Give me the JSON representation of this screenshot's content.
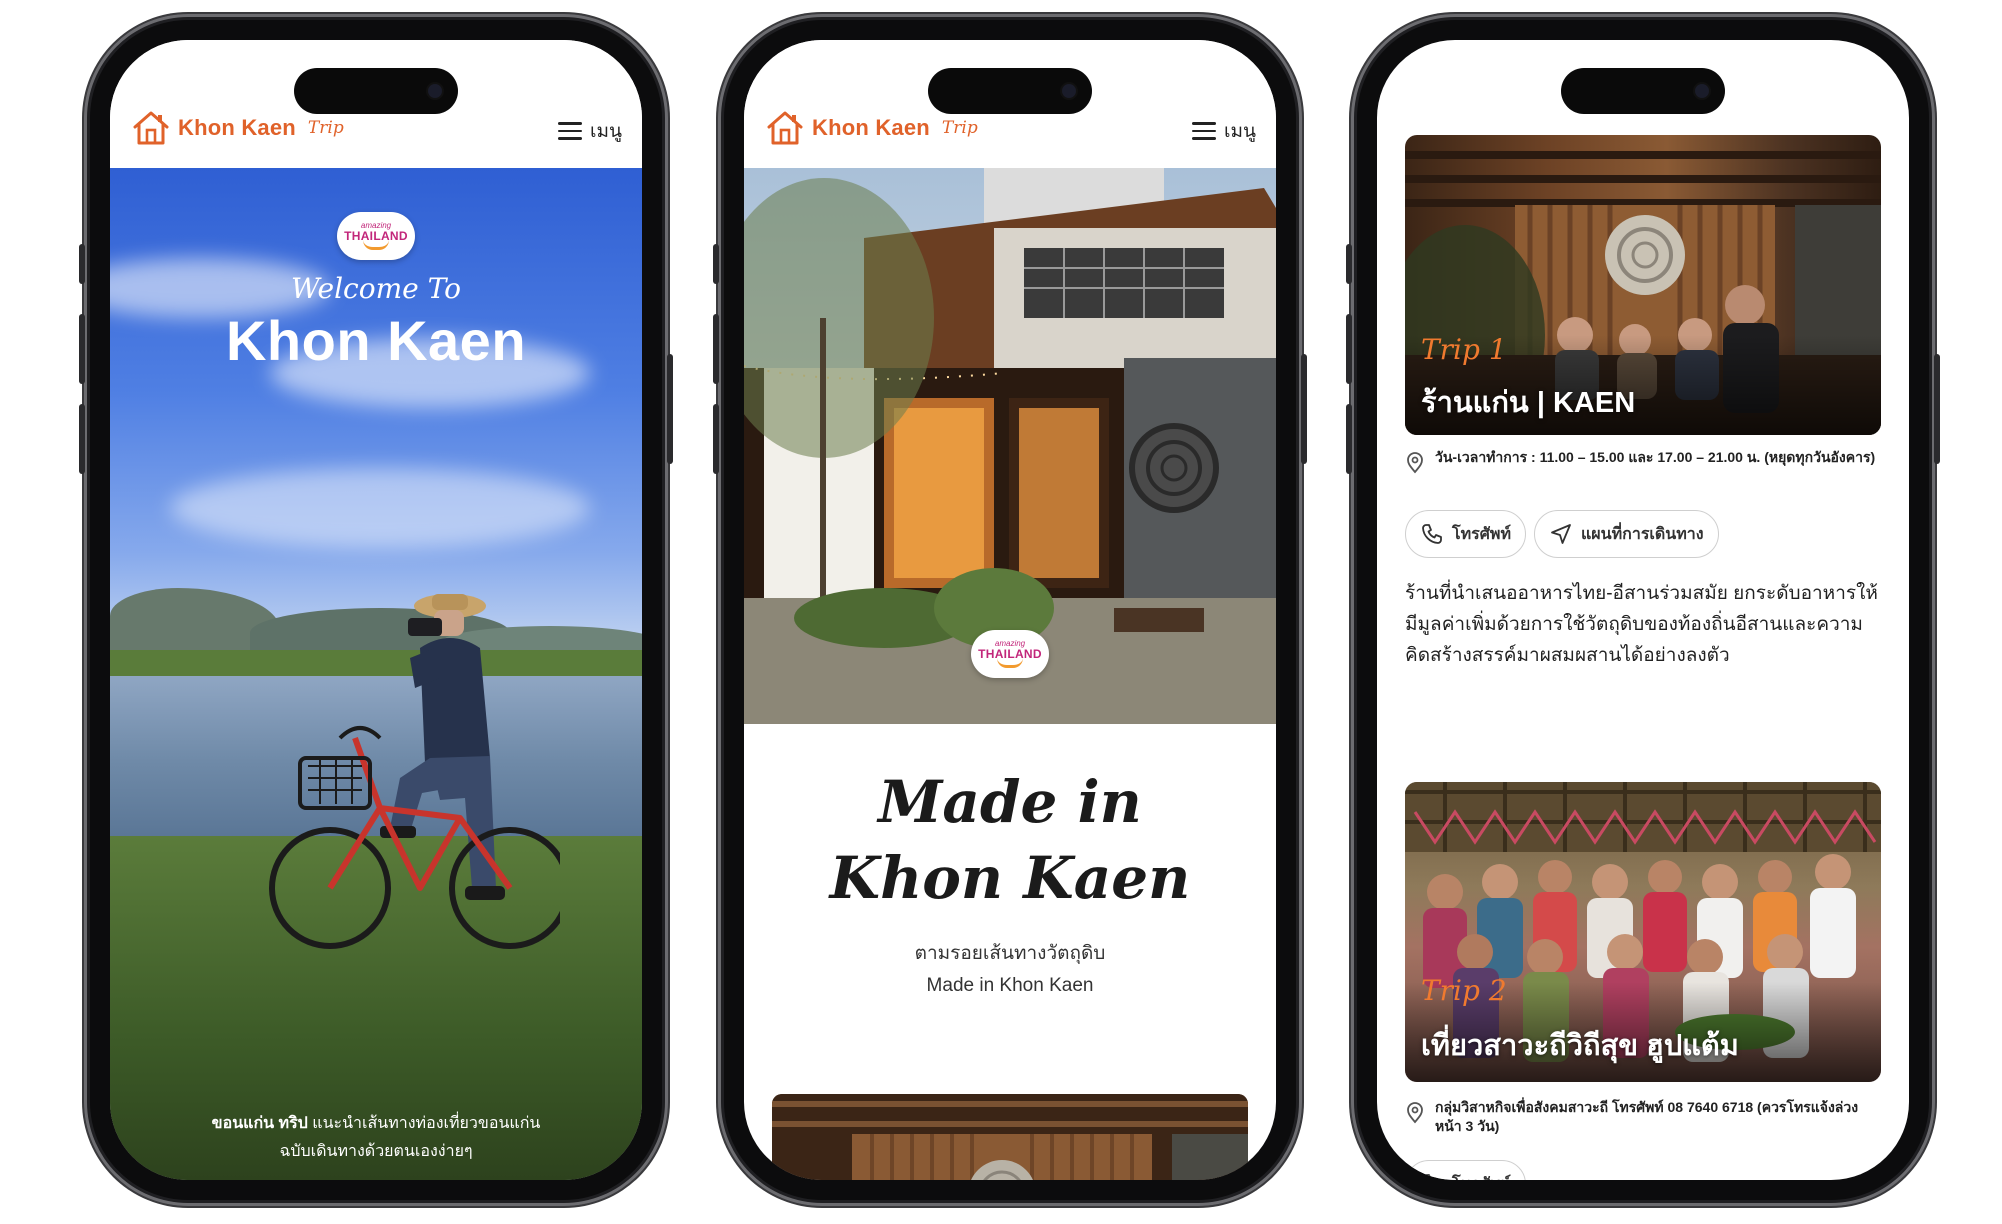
{
  "brand": {
    "name": "Khon Kaen",
    "trip": "Trip",
    "color": "#e0622a"
  },
  "menu_label": "เมนู",
  "badge": {
    "small": "amazing",
    "big": "THAILAND"
  },
  "phone1": {
    "welcome": "Welcome To",
    "title": "Khon Kaen",
    "footer_bold": "ขอนแก่น ทริป",
    "footer_line1_rest": " แนะนำเส้นทางท่องเที่ยวขอนแก่น",
    "footer_line2": "ฉบับเดินทางด้วยตนเองง่ายๆ"
  },
  "phone2": {
    "headline_line1": "Made in",
    "headline_line2": "Khon Kaen",
    "sub_line1": "ตามรอยเส้นทางวัตถุดิบ",
    "sub_line2": "Made in Khon Kaen"
  },
  "phone3": {
    "card1": {
      "trip": "Trip 1",
      "title": "ร้านแก่น | KAEN",
      "hours": "วัน-เวลาทำการ : 11.00 – 15.00 และ 17.00 – 21.00 น. (หยุดทุกวันอังคาร)",
      "call": "โทรศัพท์",
      "map": "แผนที่การเดินทาง",
      "desc": "ร้านที่นำเสนออาหารไทย-อีสานร่วมสมัย ยกระดับอาหารให้มีมูลค่าเพิ่มด้วยการใช้วัตถุดิบของท้องถิ่นอีสานและความคิดสร้างสรรค์มาผสมผสานได้อย่างลงตัว"
    },
    "card2": {
      "trip": "Trip 2",
      "title": "เที่ยวสาวะถีวิถีสุข ฮูปแต้ม",
      "info": "กลุ่มวิสาหกิจเพื่อสังคมสาวะถี โทรศัพท์ 08 7640 6718 (ควรโทรแจ้งล่วงหน้า 3 วัน)",
      "call": "โทรศัพท์"
    }
  }
}
